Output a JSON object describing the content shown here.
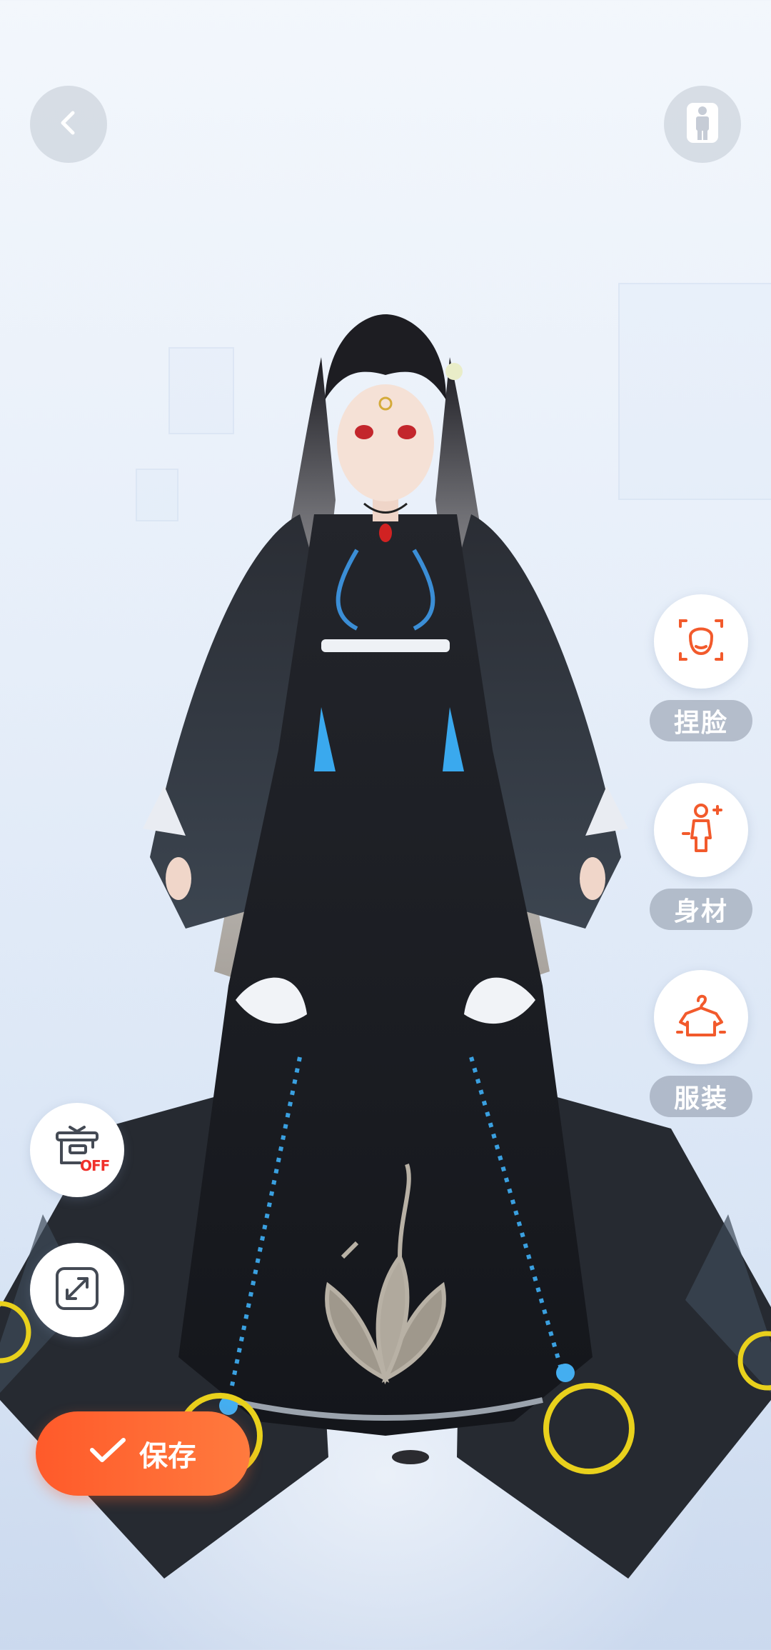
{
  "toolbar": {
    "back_icon": "chevron-left-icon",
    "pose_icon": "person-pose-icon"
  },
  "side_tools": [
    {
      "label": "捏脸",
      "icon": "face-edit-icon"
    },
    {
      "label": "身材",
      "icon": "body-shape-icon"
    },
    {
      "label": "服装",
      "icon": "clothing-hanger-icon"
    }
  ],
  "left_tools": {
    "showcase_toggle": {
      "icon": "display-stand-icon",
      "state_label": "OFF"
    },
    "fullscreen_icon": "expand-icon"
  },
  "save_button": {
    "label": "保存",
    "icon": "checkmark-icon"
  },
  "colors": {
    "accent": "#ff5a2a",
    "icon_orange": "#f25a2c",
    "pill_bg": "#8c96a5",
    "background_top": "#f3f7fc",
    "background_bottom": "#cbd9ee"
  }
}
